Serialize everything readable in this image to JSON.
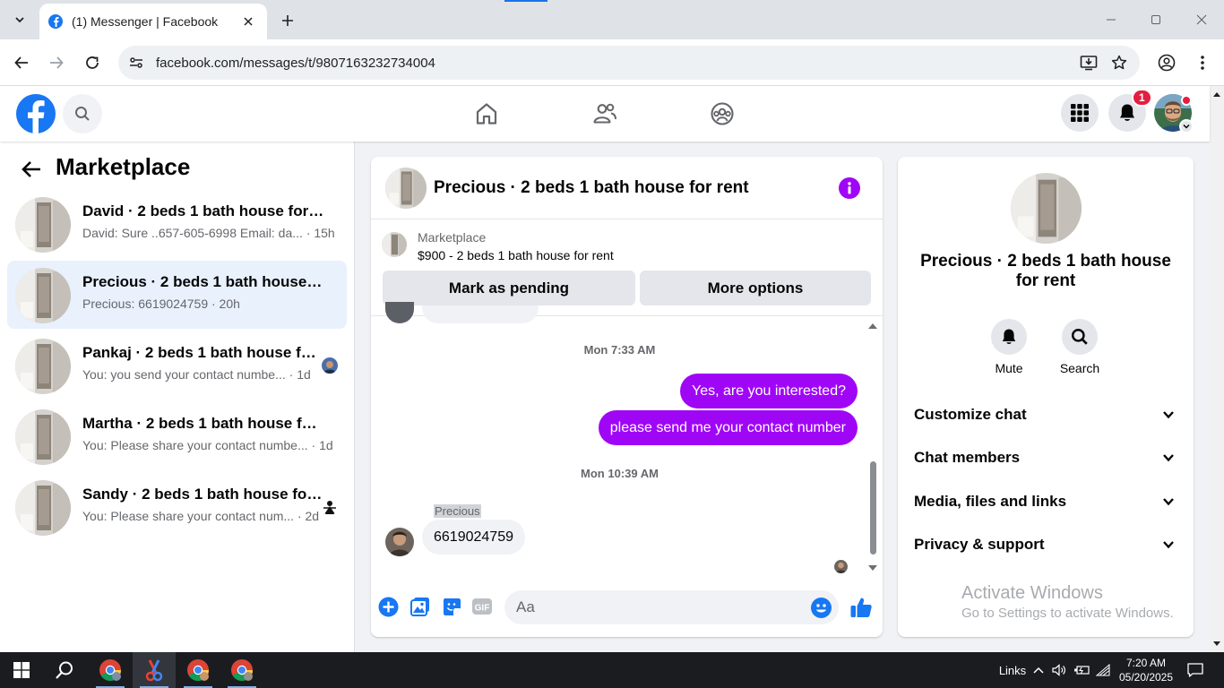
{
  "browser": {
    "tab_title": "(1) Messenger | Facebook",
    "url": "facebook.com/messages/t/9807163232734004",
    "accent_color": "#1a73e8"
  },
  "fb_header": {
    "brand_color": "#1877f2",
    "notification_count": "1",
    "nav_icons": [
      "home-icon",
      "friends-icon",
      "groups-icon"
    ],
    "right_icons": [
      "menu-grid-icon",
      "bell-icon",
      "profile-avatar"
    ]
  },
  "sidebar": {
    "title": "Marketplace",
    "conversations": [
      {
        "title": "David · 2 beds 1 bath house for rent",
        "preview": "David: Sure ..657-605-6998 Email: da...",
        "time": " · 15h",
        "active": false
      },
      {
        "title": "Precious · 2 beds 1 bath house for ...",
        "preview": "Precious: 6619024759",
        "time": " · 20h",
        "active": true
      },
      {
        "title": "Pankaj · 2 beds 1 bath house for ...",
        "preview": "You: you send your contact numbe...",
        "time": " · 1d",
        "active": false
      },
      {
        "title": "Martha · 2 beds 1 bath house for r...",
        "preview": "You: Please share your contact numbe...",
        "time": " · 1d",
        "active": false
      },
      {
        "title": "Sandy · 2 beds 1 bath house for ...",
        "preview": "You: Please share your contact num...",
        "time": " · 2d",
        "active": false
      }
    ]
  },
  "chat": {
    "title": "Precious · 2 beds 1 bath house for rent",
    "listing_source": "Marketplace",
    "listing_line": "$900 - 2 beds 1 bath house for rent",
    "btn_pending": "Mark as pending",
    "btn_more": "More options",
    "timestamp_1": "Mon 7:33 AM",
    "out_message_1": "Yes, are you interested?",
    "out_message_2": "please send me your contact number",
    "timestamp_2": "Mon 10:39 AM",
    "sender_name": "Precious",
    "in_message_1": "6619024759",
    "composer_placeholder": "Aa",
    "bubble_color": "#a006f6"
  },
  "info_panel": {
    "title": "Precious · 2 beds 1 bath house for rent",
    "mute_label": "Mute",
    "search_label": "Search",
    "sections": [
      "Customize chat",
      "Chat members",
      "Media, files and links",
      "Privacy & support"
    ]
  },
  "watermark": {
    "line1": "Activate Windows",
    "line2": "Go to Settings to activate Windows."
  },
  "taskbar": {
    "links_label": "Links",
    "time": "7:20 AM",
    "date": "05/20/2025"
  }
}
